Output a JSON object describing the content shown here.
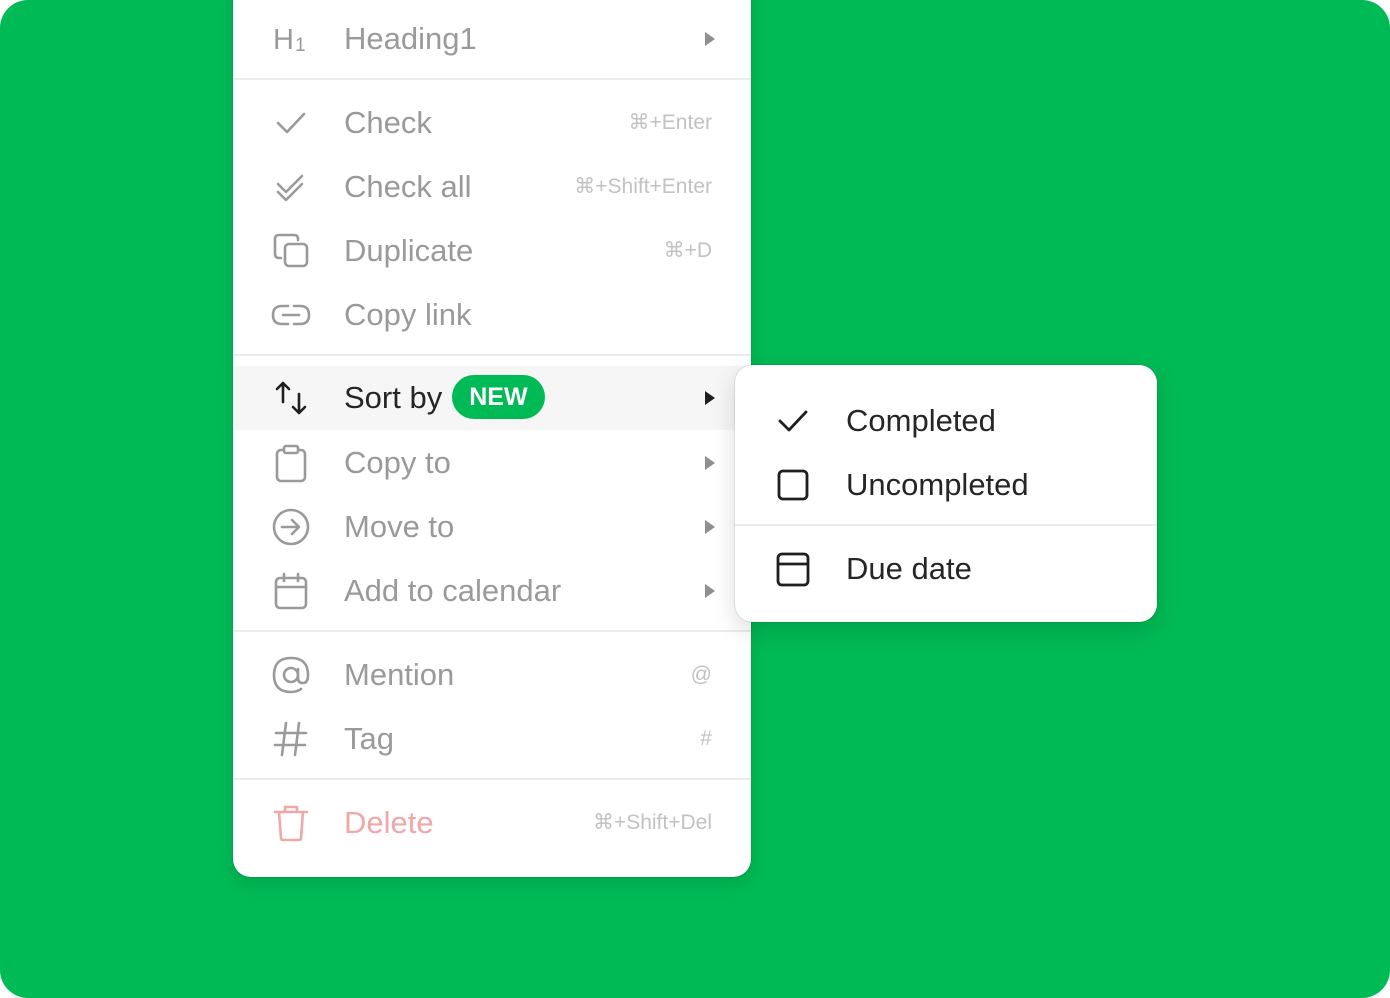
{
  "colors": {
    "background": "#00ba55",
    "accent": "#00ba55",
    "danger": "#f2a7a7",
    "muted_text": "#9a9a9a",
    "active_text": "#262626"
  },
  "menu": {
    "heading": {
      "icon": "heading1-icon",
      "label": "Heading1",
      "icon_text": "H",
      "icon_sub": "1"
    },
    "items": [
      {
        "icon": "check-icon",
        "label": "Check",
        "shortcut": "⌘+Enter"
      },
      {
        "icon": "check-all-icon",
        "label": "Check all",
        "shortcut": "⌘+Shift+Enter"
      },
      {
        "icon": "duplicate-icon",
        "label": "Duplicate",
        "shortcut": "⌘+D"
      },
      {
        "icon": "link-icon",
        "label": "Copy link",
        "shortcut": ""
      }
    ],
    "submenus": [
      {
        "icon": "sort-arrows-icon",
        "label": "Sort by",
        "badge": "NEW",
        "active": true
      },
      {
        "icon": "clipboard-icon",
        "label": "Copy to"
      },
      {
        "icon": "arrow-circle-right-icon",
        "label": "Move to"
      },
      {
        "icon": "calendar-icon",
        "label": "Add to calendar"
      }
    ],
    "inserts": [
      {
        "icon": "at-sign-icon",
        "label": "Mention",
        "shortcut": "@"
      },
      {
        "icon": "hash-icon",
        "label": "Tag",
        "shortcut": "#"
      }
    ],
    "delete": {
      "icon": "trash-icon",
      "label": "Delete",
      "shortcut": "⌘+Shift+Del"
    }
  },
  "sort_submenu": {
    "items": [
      {
        "icon": "check-icon",
        "label": "Completed",
        "selected": true
      },
      {
        "icon": "checkbox-empty-icon",
        "label": "Uncompleted",
        "selected": false
      },
      {
        "icon": "calendar-blank-icon",
        "label": "Due date",
        "selected": false
      }
    ]
  }
}
